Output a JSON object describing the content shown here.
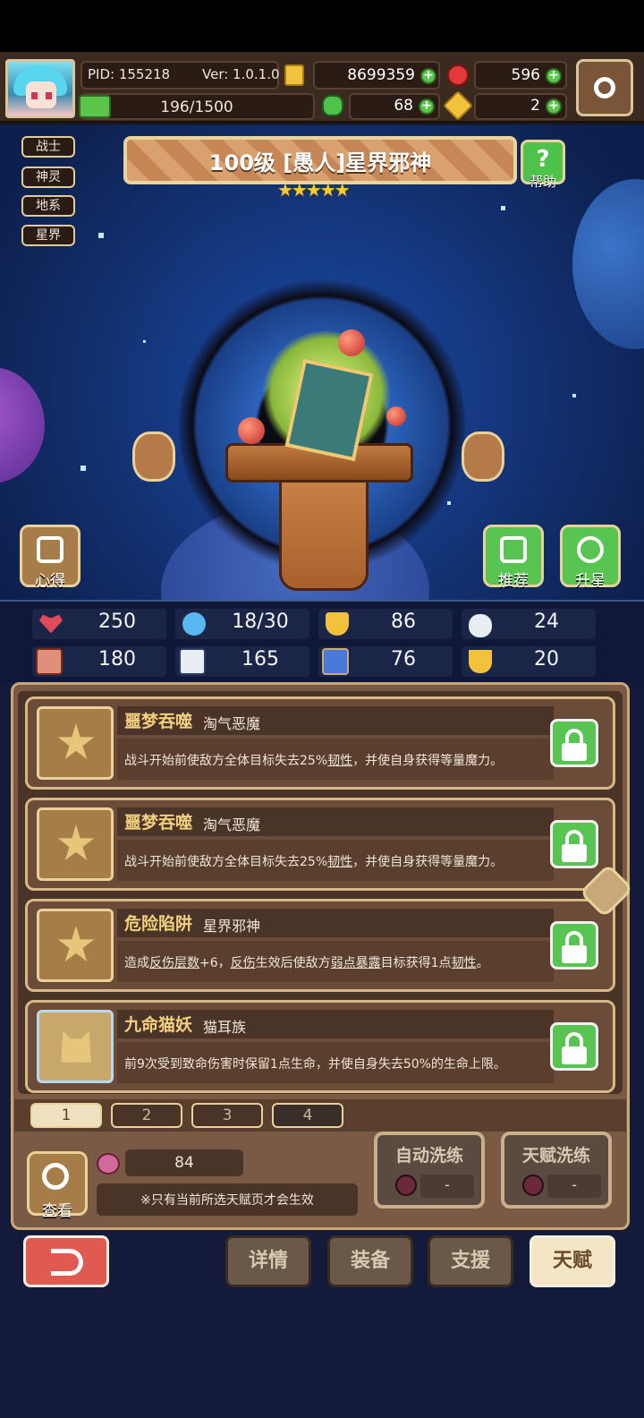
{
  "header": {
    "pid": "PID: 155218",
    "version": "Ver: 1.0.1.0",
    "gold": "8699359",
    "gems": "596",
    "exp": "196/1500",
    "clover": "68",
    "keys": "2"
  },
  "categories": [
    "战士",
    "神灵",
    "地系",
    "星界"
  ],
  "hero": {
    "title": "100级 [愚人]星界邪神",
    "stars": "★★★★★",
    "rating": 5
  },
  "buttons": {
    "help": "帮助",
    "notes": "心得",
    "recommend": "推荐",
    "star_up": "升星"
  },
  "stats": [
    "250",
    "18/30",
    "86",
    "24",
    "180",
    "165",
    "76",
    "20"
  ],
  "talents": [
    {
      "name": "噩梦吞噬",
      "race": "淘气恶魔",
      "desc_a": "战斗开始前使敌方全体目标失去25%",
      "desc_u1": "韧性",
      "desc_b": "，并使自身获得等量魔力。"
    },
    {
      "name": "噩梦吞噬",
      "race": "淘气恶魔",
      "desc_a": "战斗开始前使敌方全体目标失去25%",
      "desc_u1": "韧性",
      "desc_b": "，并使自身获得等量魔力。"
    },
    {
      "name": "危险陷阱",
      "race": "星界邪神",
      "desc_a": "造成",
      "desc_u1": "反伤层数",
      "desc_b": "+6，",
      "desc_u2": "反伤",
      "desc_c": "生效后使敌方",
      "desc_u3": "弱点暴露",
      "desc_d": "目标获得1点",
      "desc_u4": "韧性",
      "desc_e": "。"
    },
    {
      "name": "九命猫妖",
      "race": "猫耳族",
      "desc": "前9次受到致命伤害时保留1点生命，并使自身失去50%的生命上限。"
    }
  ],
  "pages": [
    "1",
    "2",
    "3",
    "4"
  ],
  "bottom": {
    "view": "查看",
    "fruit": "84",
    "note": "※只有当前所选天赋页才会生效",
    "auto_reroll": "自动洗练",
    "auto_cost": "-",
    "talent_reroll": "天赋洗练",
    "talent_cost": "-"
  },
  "nav": {
    "details": "详情",
    "equipment": "装备",
    "support": "支援",
    "talent": "天赋"
  },
  "colors": {
    "panel_brown": "#7a5a44",
    "accent_gold": "#f2d080",
    "lock_green": "#58c452",
    "back_red": "#e05a52"
  }
}
